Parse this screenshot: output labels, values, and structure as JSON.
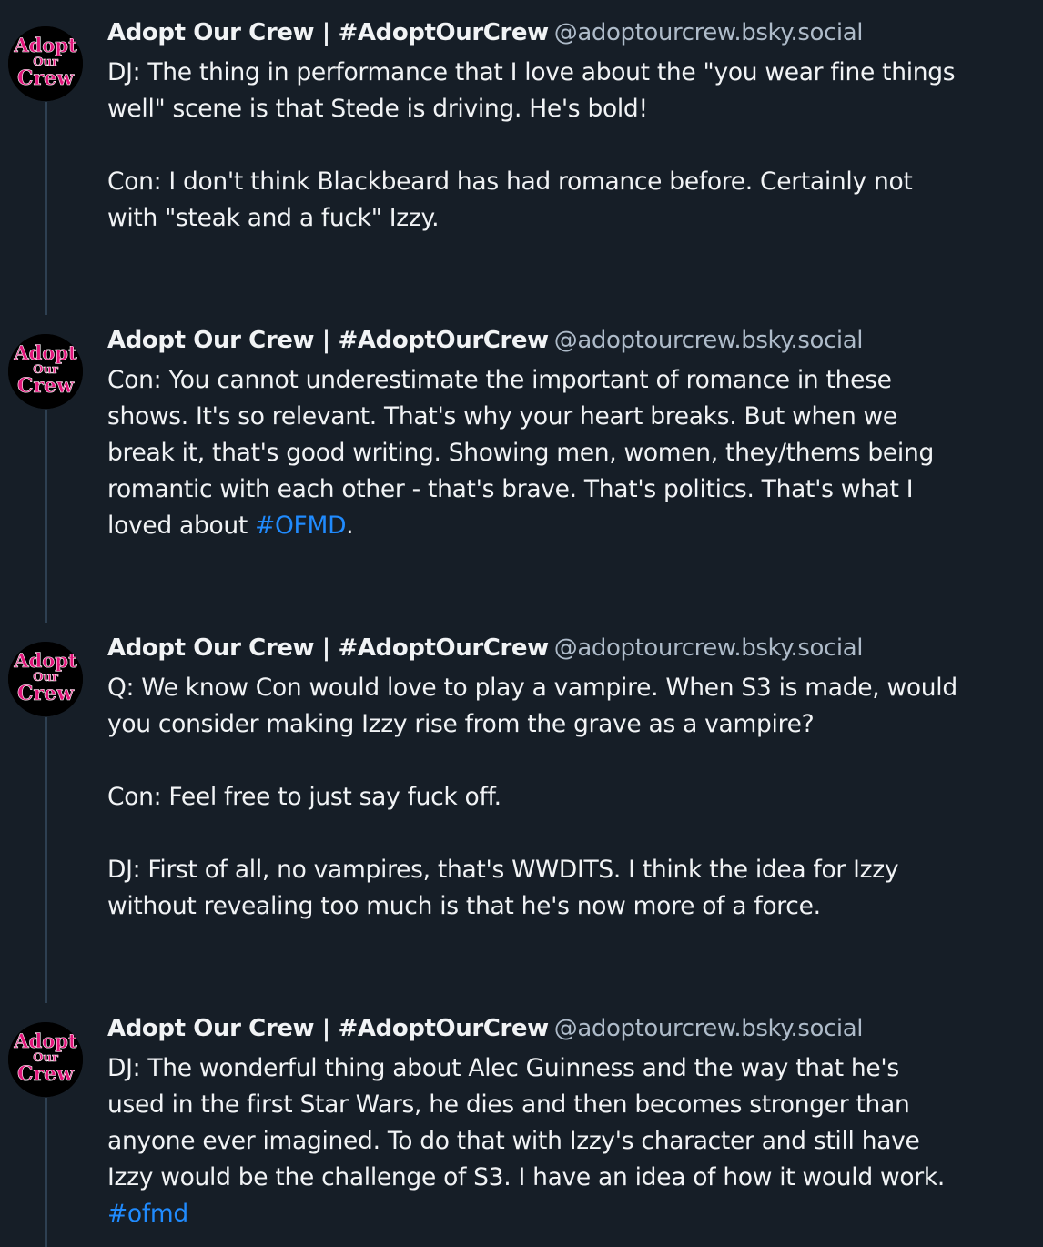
{
  "posts": [
    {
      "display_name": "Adopt Our Crew | #AdoptOurCrew",
      "handle": "@adoptourcrew.bsky.social",
      "paragraphs": [
        {
          "lines": [
            "DJ: The thing in performance that I love about the \"you wear fine things",
            "well\" scene is that Stede is driving. He's bold!"
          ]
        },
        {
          "lines": [
            "Con: I don't think Blackbeard has had romance before. Certainly not",
            "with \"steak and a fuck\" Izzy."
          ]
        }
      ]
    },
    {
      "display_name": "Adopt Our Crew | #AdoptOurCrew",
      "handle": "@adoptourcrew.bsky.social",
      "paragraphs": [
        {
          "lines": [
            "Con: You cannot underestimate the important of romance in these",
            "shows. It's so relevant. That's why your heart breaks. But when we",
            "break it, that's good writing. Showing men, women, they/thems being",
            "romantic with each other - that's brave. That's politics. That's what I"
          ],
          "last_line_pre": "loved about ",
          "last_line_tag": "#OFMD",
          "last_line_post": "."
        }
      ]
    },
    {
      "display_name": "Adopt Our Crew | #AdoptOurCrew",
      "handle": "@adoptourcrew.bsky.social",
      "paragraphs": [
        {
          "lines": [
            "Q: We know Con would love to play a vampire. When S3 is made, would",
            "you consider making Izzy rise from the grave as a vampire?"
          ]
        },
        {
          "lines": [
            "Con: Feel free to just say fuck off."
          ]
        },
        {
          "lines": [
            "DJ: First of all, no vampires, that's WWDITS. I think the idea for Izzy",
            "without revealing too much is that he's now more of a force."
          ]
        }
      ]
    },
    {
      "display_name": "Adopt Our Crew | #AdoptOurCrew",
      "handle": "@adoptourcrew.bsky.social",
      "paragraphs": [
        {
          "lines": [
            "DJ: The wonderful thing about Alec Guinness and the way that he's",
            "used in the first Star Wars, he dies and then becomes stronger than",
            "anyone ever imagined. To do that with Izzy's character and still have",
            "Izzy would be the challenge of S3. I have an idea of how it would work."
          ],
          "tag_line": "#ofmd"
        }
      ]
    }
  ],
  "avatar": {
    "logo_words": [
      "Adopt",
      "Our",
      "Crew"
    ],
    "logo_color": "#e0157a",
    "logo_outline_color": "#ffffff"
  },
  "colors": {
    "background": "#161e27",
    "thread_line": "#2e4052",
    "text": "#f1f3f5",
    "handle": "#aebbc9",
    "hashtag": "#208bfe"
  }
}
